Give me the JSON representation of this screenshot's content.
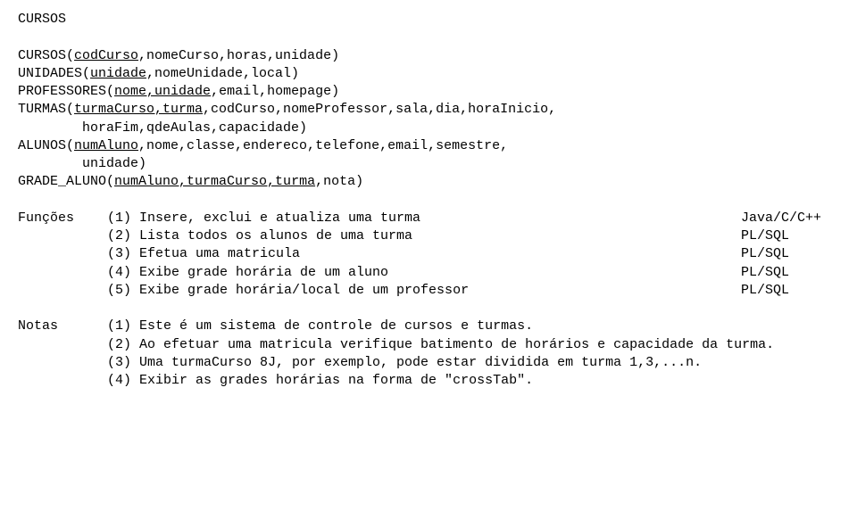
{
  "title": "CURSOS",
  "schema": {
    "cursos_pre": "CURSOS(",
    "cursos_u": "codCurso",
    "cursos_post": ",nomeCurso,horas,unidade)",
    "unidades_pre": "UNIDADES(",
    "unidades_u": "unidade",
    "unidades_post": ",nomeUnidade,local)",
    "professores_pre": "PROFESSORES(",
    "professores_u": "nome,unidade",
    "professores_post": ",email,homepage)",
    "turmas_pre": "TURMAS(",
    "turmas_u": "turmaCurso,turma",
    "turmas_post": ",codCurso,nomeProfessor,sala,dia,horaInicio,",
    "turmas_cont": "        horaFim,qdeAulas,capacidade)",
    "alunos_pre": "ALUNOS(",
    "alunos_u": "numAluno",
    "alunos_post": ",nome,classe,endereco,telefone,email,semestre,",
    "alunos_cont": "        unidade)",
    "grade_pre": "GRADE_ALUNO(",
    "grade_u": "numAluno,turmaCurso,turma",
    "grade_post": ",nota)"
  },
  "funcs": {
    "label": "Funções",
    "items": [
      {
        "t": "(1) Insere, exclui e atualiza uma turma",
        "l": "Java/C/C++"
      },
      {
        "t": "(2) Lista todos os alunos de uma turma",
        "l": "PL/SQL"
      },
      {
        "t": "(3) Efetua uma matricula",
        "l": "PL/SQL"
      },
      {
        "t": "(4) Exibe grade horária de um aluno",
        "l": "PL/SQL"
      },
      {
        "t": "(5) Exibe grade horária/local de um professor",
        "l": "PL/SQL"
      }
    ]
  },
  "notes": {
    "label": "Notas",
    "items": [
      "(1) Este é um sistema de controle de cursos e turmas.",
      "(2) Ao efetuar uma matricula verifique batimento de horários e capacidade da turma.",
      "(3) Uma turmaCurso 8J, por exemplo, pode estar dividida em turma 1,3,...n.",
      "(4) Exibir as grades horárias na forma de \"crossTab\"."
    ]
  }
}
